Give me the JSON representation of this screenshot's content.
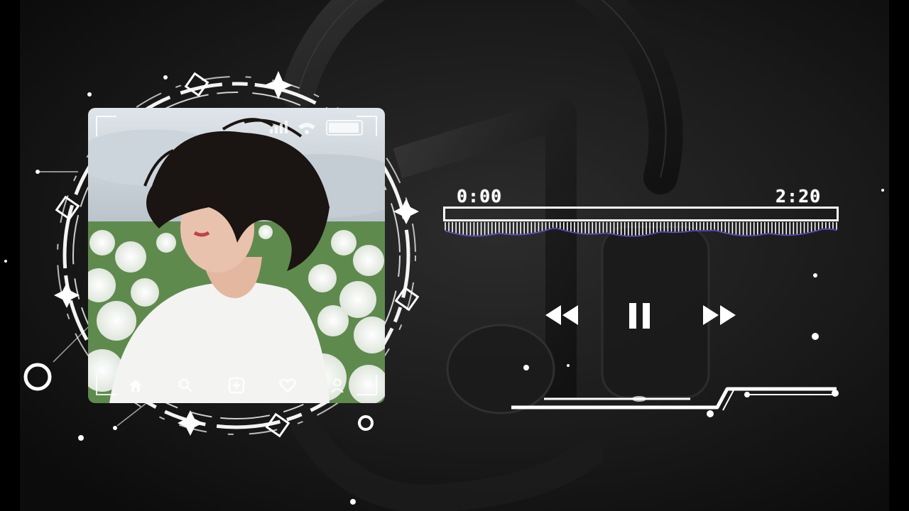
{
  "colors": {
    "background": "#000000",
    "panel": "#151515",
    "accent": "#ffffff",
    "waveform_glow": "#6a5cff"
  },
  "player": {
    "current_time": "0:00",
    "total_time": "2:20",
    "progress": 0.0,
    "state": "playing"
  },
  "controls": {
    "previous_icon": "rewind-icon",
    "pause_icon": "pause-icon",
    "next_icon": "fast-forward-icon"
  },
  "cover": {
    "status_icons": [
      "signal-icon",
      "wifi-icon",
      "battery-icon"
    ],
    "bottom_icons": [
      "home-icon",
      "search-icon",
      "add-icon",
      "heart-icon",
      "profile-icon"
    ]
  },
  "background_icon": "music-note-headphones-icon"
}
